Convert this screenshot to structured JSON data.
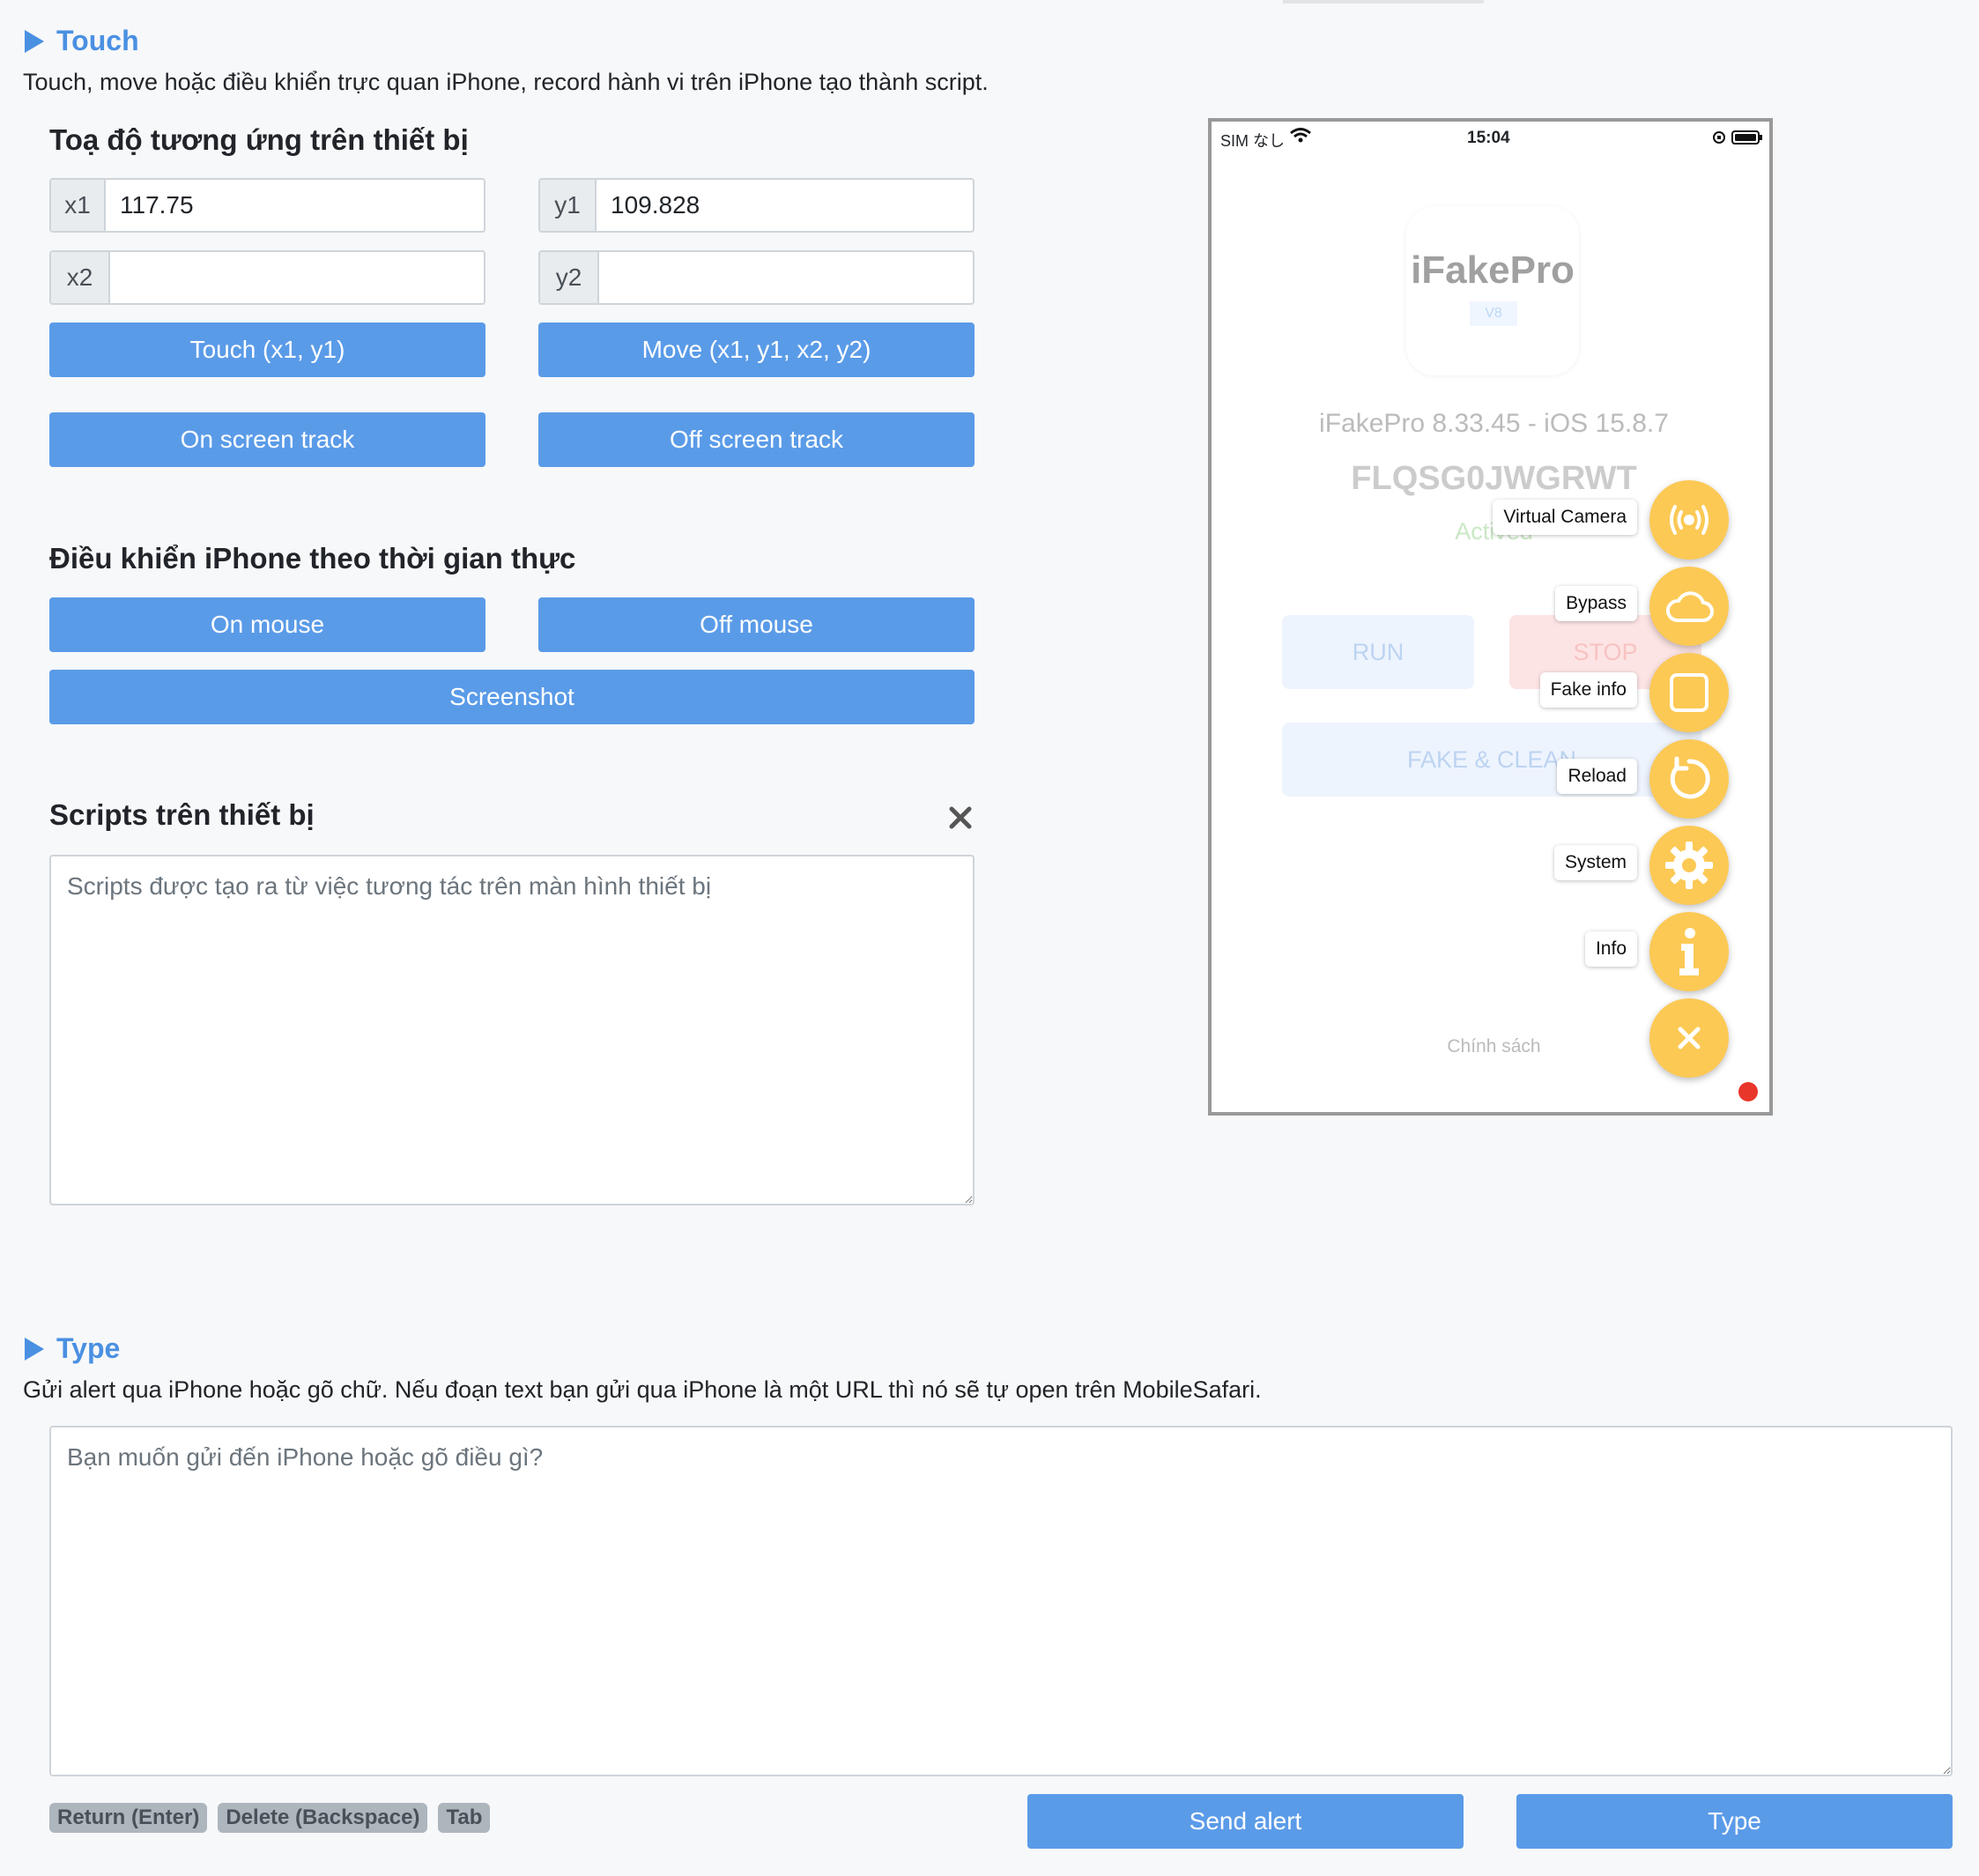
{
  "touch": {
    "title": "Touch",
    "description": "Touch, move hoặc điều khiển trực quan iPhone, record hành vi trên iPhone tạo thành script.",
    "coords_heading": "Toạ độ tương ứng trên thiết bị",
    "x1_label": "x1",
    "x1_value": "117.75",
    "y1_label": "y1",
    "y1_value": "109.828",
    "x2_label": "x2",
    "x2_value": "",
    "y2_label": "y2",
    "y2_value": "",
    "touch_button": "Touch (x1, y1)",
    "move_button": "Move (x1, y1, x2, y2)",
    "on_track_button": "On screen track",
    "off_track_button": "Off screen track",
    "realtime_heading": "Điều khiển iPhone theo thời gian thực",
    "on_mouse_button": "On mouse",
    "off_mouse_button": "Off mouse",
    "screenshot_button": "Screenshot",
    "scripts_heading": "Scripts trên thiết bị",
    "scripts_placeholder": "Scripts được tạo ra từ việc tương tác trên màn hình thiết bị"
  },
  "phone": {
    "carrier": "SIM なし",
    "time": "15:04",
    "app_logo_text": "iFakePro",
    "app_logo_badge": "V8",
    "version_text": "iFakePro 8.33.45 - iOS 15.8.7",
    "device_id": "FLQSG0JWGRWT",
    "status": "Actived",
    "run_label": "RUN",
    "stop_label": "STOP",
    "fake_clean_label": "FAKE & CLEAN",
    "policy_label": "Chính sách",
    "menu": [
      {
        "label": "Virtual Camera",
        "icon": "broadcast-icon"
      },
      {
        "label": "Bypass",
        "icon": "cloud-icon"
      },
      {
        "label": "Fake info",
        "icon": "square-icon"
      },
      {
        "label": "Reload",
        "icon": "reload-icon"
      },
      {
        "label": "System",
        "icon": "gear-icon"
      },
      {
        "label": "Info",
        "icon": "info-icon"
      }
    ],
    "accent_color": "#fcc955"
  },
  "type": {
    "title": "Type",
    "description": "Gửi alert qua iPhone hoặc gõ chữ. Nếu đoạn text bạn gửi qua iPhone là một URL thì nó sẽ tự open trên MobileSafari.",
    "text_placeholder": "Bạn muốn gửi đến iPhone hoặc gõ điều gì?",
    "keys": [
      "Return (Enter)",
      "Delete (Backspace)",
      "Tab"
    ],
    "send_alert_button": "Send alert",
    "type_button": "Type"
  },
  "colors": {
    "primary": "#5a9be8",
    "title": "#4a90e2"
  }
}
